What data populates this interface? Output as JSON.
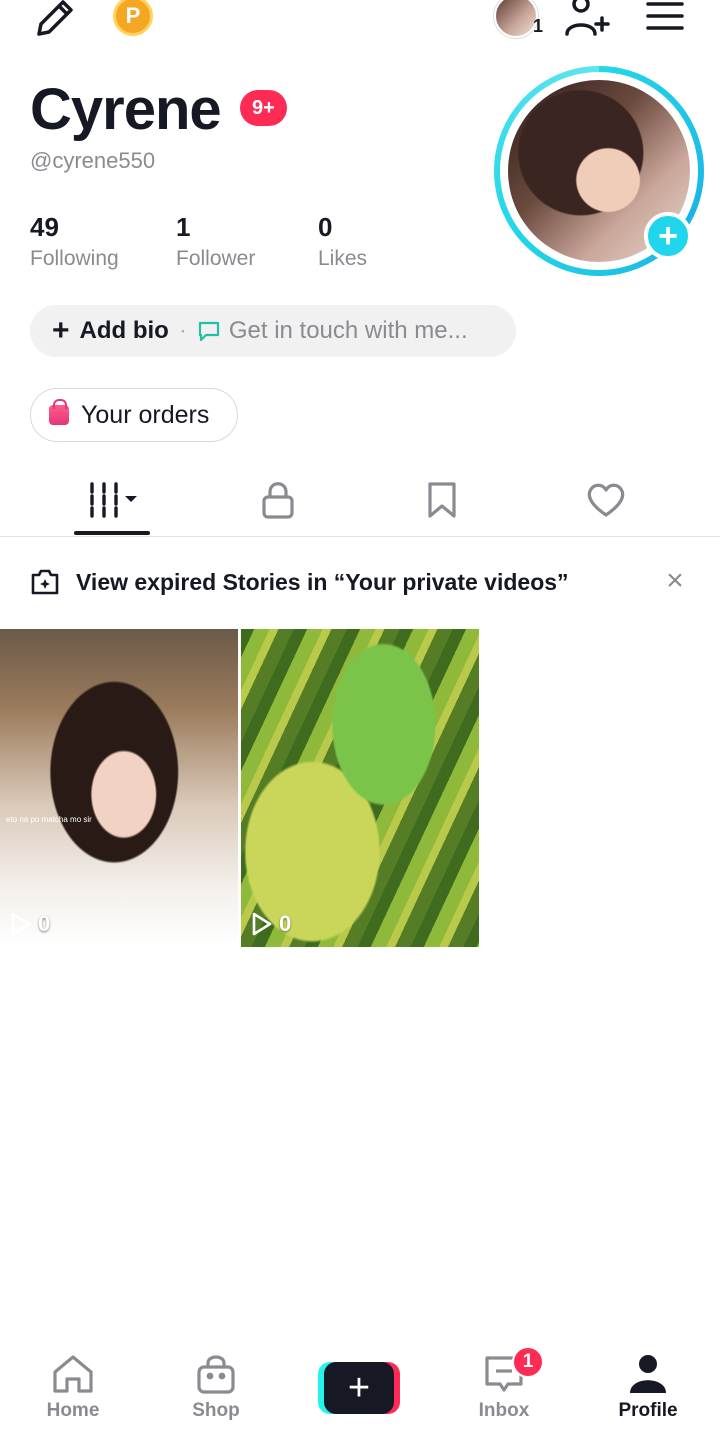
{
  "topbar": {
    "coin_letter": "P",
    "friend_count": "1"
  },
  "profile": {
    "name": "Cyrene",
    "notification_badge": "9+",
    "handle": "@cyrene550",
    "stats": [
      {
        "value": "49",
        "label": "Following"
      },
      {
        "value": "1",
        "label": "Follower"
      },
      {
        "value": "0",
        "label": "Likes"
      }
    ],
    "add_bio_label": "Add bio",
    "bio_separator": "·",
    "contact_label": "Get in touch with me...",
    "orders_label": "Your orders"
  },
  "tabs": [
    {
      "icon": "videos-grid-icon",
      "active": true
    },
    {
      "icon": "lock-icon",
      "active": false
    },
    {
      "icon": "bookmark-icon",
      "active": false
    },
    {
      "icon": "heart-icon",
      "active": false
    }
  ],
  "banner": {
    "text": "View expired Stories in “Your private videos”"
  },
  "videos": [
    {
      "views": "0",
      "caption": "eto na po matcha mo sir"
    },
    {
      "views": "0"
    }
  ],
  "nav": {
    "items": [
      {
        "label": "Home",
        "icon": "home-icon"
      },
      {
        "label": "Shop",
        "icon": "shop-bag-icon"
      },
      {
        "label": "Inbox",
        "icon": "inbox-icon",
        "badge": "1"
      },
      {
        "label": "Profile",
        "icon": "profile-icon",
        "active": true
      }
    ]
  },
  "colors": {
    "accent_red": "#fe2c55",
    "accent_cyan": "#25f4ee",
    "avatar_plus": "#20d5ec",
    "text_primary": "#161823",
    "text_secondary": "#8a8b91"
  }
}
